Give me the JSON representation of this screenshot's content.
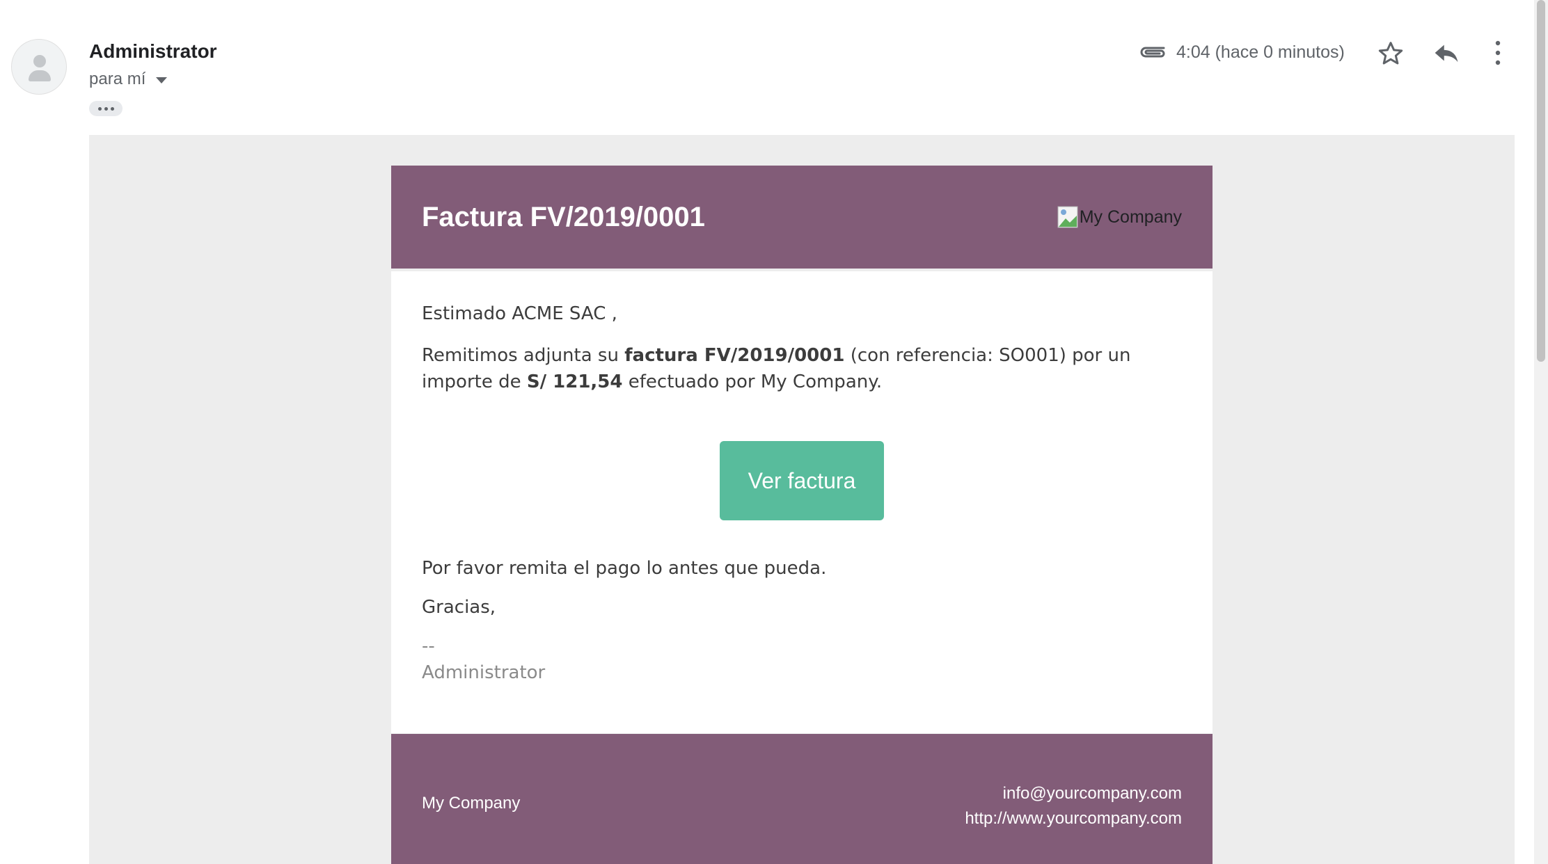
{
  "header": {
    "sender_name": "Administrator",
    "recipient_label": "para mí",
    "timestamp": "4:04 (hace 0 minutos)",
    "icons": [
      "attachment-icon",
      "star-icon",
      "reply-icon",
      "more-vert-icon"
    ]
  },
  "email": {
    "title": "Factura FV/2019/0001",
    "logo_alt": "My Company",
    "greeting": "Estimado ACME SAC ,",
    "body_part1": "Remitimos adjunta su ",
    "body_bold1": "factura FV/2019/0001",
    "body_part2": " (con referencia: SO001) por un importe de ",
    "body_bold2": "S/ 121,54",
    "body_part3": " efectuado por My Company.",
    "button_label": "Ver factura",
    "payment_note": "Por favor remita el pago lo antes que pueda.",
    "thanks": "Gracias,",
    "signature_dash": "--",
    "signature_name": "Administrator",
    "footer_company": "My Company",
    "footer_email": "info@yourcompany.com",
    "footer_website": "http://www.yourcompany.com"
  },
  "colors": {
    "brand_purple": "#825c78",
    "button_green": "#58bc9c",
    "mail_background": "#ededed"
  }
}
